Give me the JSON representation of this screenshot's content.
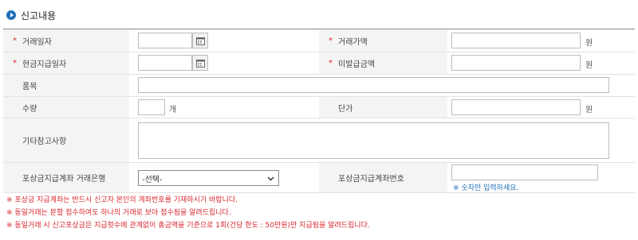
{
  "section": {
    "title": "신고내용"
  },
  "fields": {
    "trade_date": {
      "label": "거래일자",
      "value": ""
    },
    "trade_amount": {
      "label": "거래가액",
      "value": "",
      "unit": "원"
    },
    "cash_date": {
      "label": "현금지급일자",
      "value": ""
    },
    "unpaid_amount": {
      "label": "미발급금액",
      "value": "",
      "unit": "원"
    },
    "item": {
      "label": "품목",
      "value": ""
    },
    "quantity": {
      "label": "수량",
      "value": "",
      "unit": "개"
    },
    "unit_price": {
      "label": "단가",
      "value": "",
      "unit": "원"
    },
    "remarks": {
      "label": "기타참고사항",
      "value": ""
    },
    "bank": {
      "label": "포상금지급계좌 거래은행",
      "selected": "-선택-"
    },
    "account": {
      "label": "포상금지급계좌번호",
      "value": "",
      "hint": "※ 숫자만 입력하세요."
    }
  },
  "required_mark": "*",
  "notes": [
    "※ 포상금 지급계좌는 반드시 신고자 본인의 계좌번호를 기재하시기 바랍니다.",
    "※ 동일거래는 분할 접수하여도 하나의 거래로 보아 접수됨을 알려드립니다.",
    "※ 동일거래 시 신고포상금은 지급횟수에 관계없이 총금액을 기준으로 1회(건당 한도 : 50만원)만 지급됨을 알려드립니다."
  ]
}
